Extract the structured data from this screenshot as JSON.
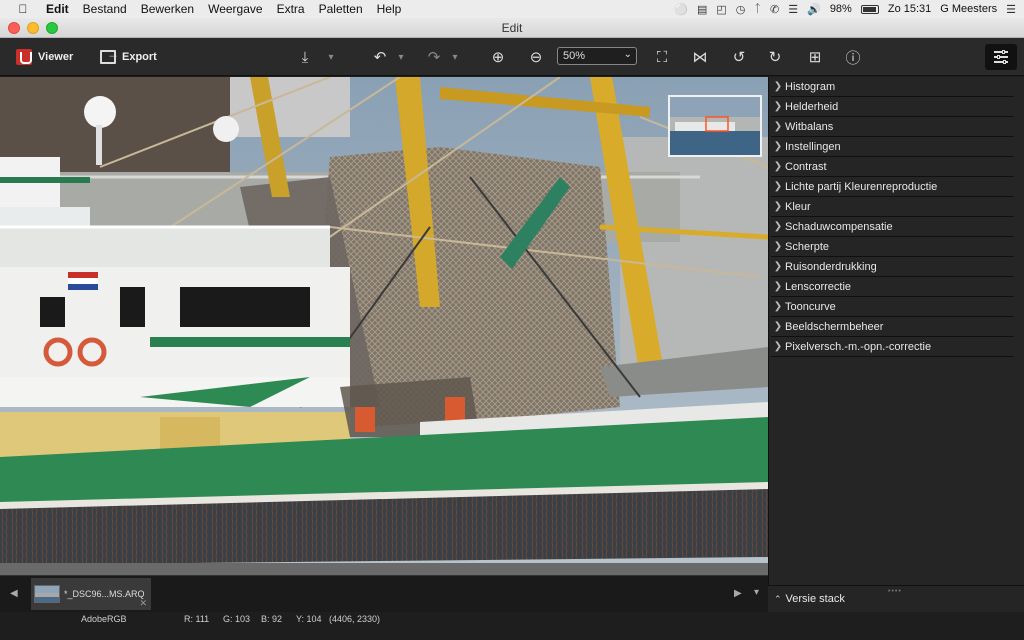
{
  "menubar": {
    "app_name": "Edit",
    "items": [
      "Bestand",
      "Bewerken",
      "Weergave",
      "Extra",
      "Paletten",
      "Help"
    ],
    "battery": "98%",
    "clock": "Zo 15:31",
    "user": "G Meesters"
  },
  "window": {
    "title": "Edit"
  },
  "toolbar": {
    "viewer_label": "Viewer",
    "export_label": "Export",
    "zoom_value": "50%"
  },
  "palette": {
    "items": [
      "Histogram",
      "Helderheid",
      "Witbalans",
      "Instellingen",
      "Contrast",
      "Lichte partij Kleurenreproductie",
      "Kleur",
      "Schaduwcompensatie",
      "Scherpte",
      "Ruisonderdrukking",
      "Lenscorrectie",
      "Tooncurve",
      "Beeldschermbeheer",
      "Pixelversch.-m.-opn.-correctie"
    ],
    "version_stack": "Versie stack"
  },
  "filmstrip": {
    "filename": "*_DSC96...MS.ARQ"
  },
  "statusbar": {
    "colorspace": "AdobeRGB",
    "r": "R: 111",
    "g": "G: 103",
    "b": "B:  92",
    "y": "Y: 104",
    "coords": "(4406, 2330)"
  }
}
